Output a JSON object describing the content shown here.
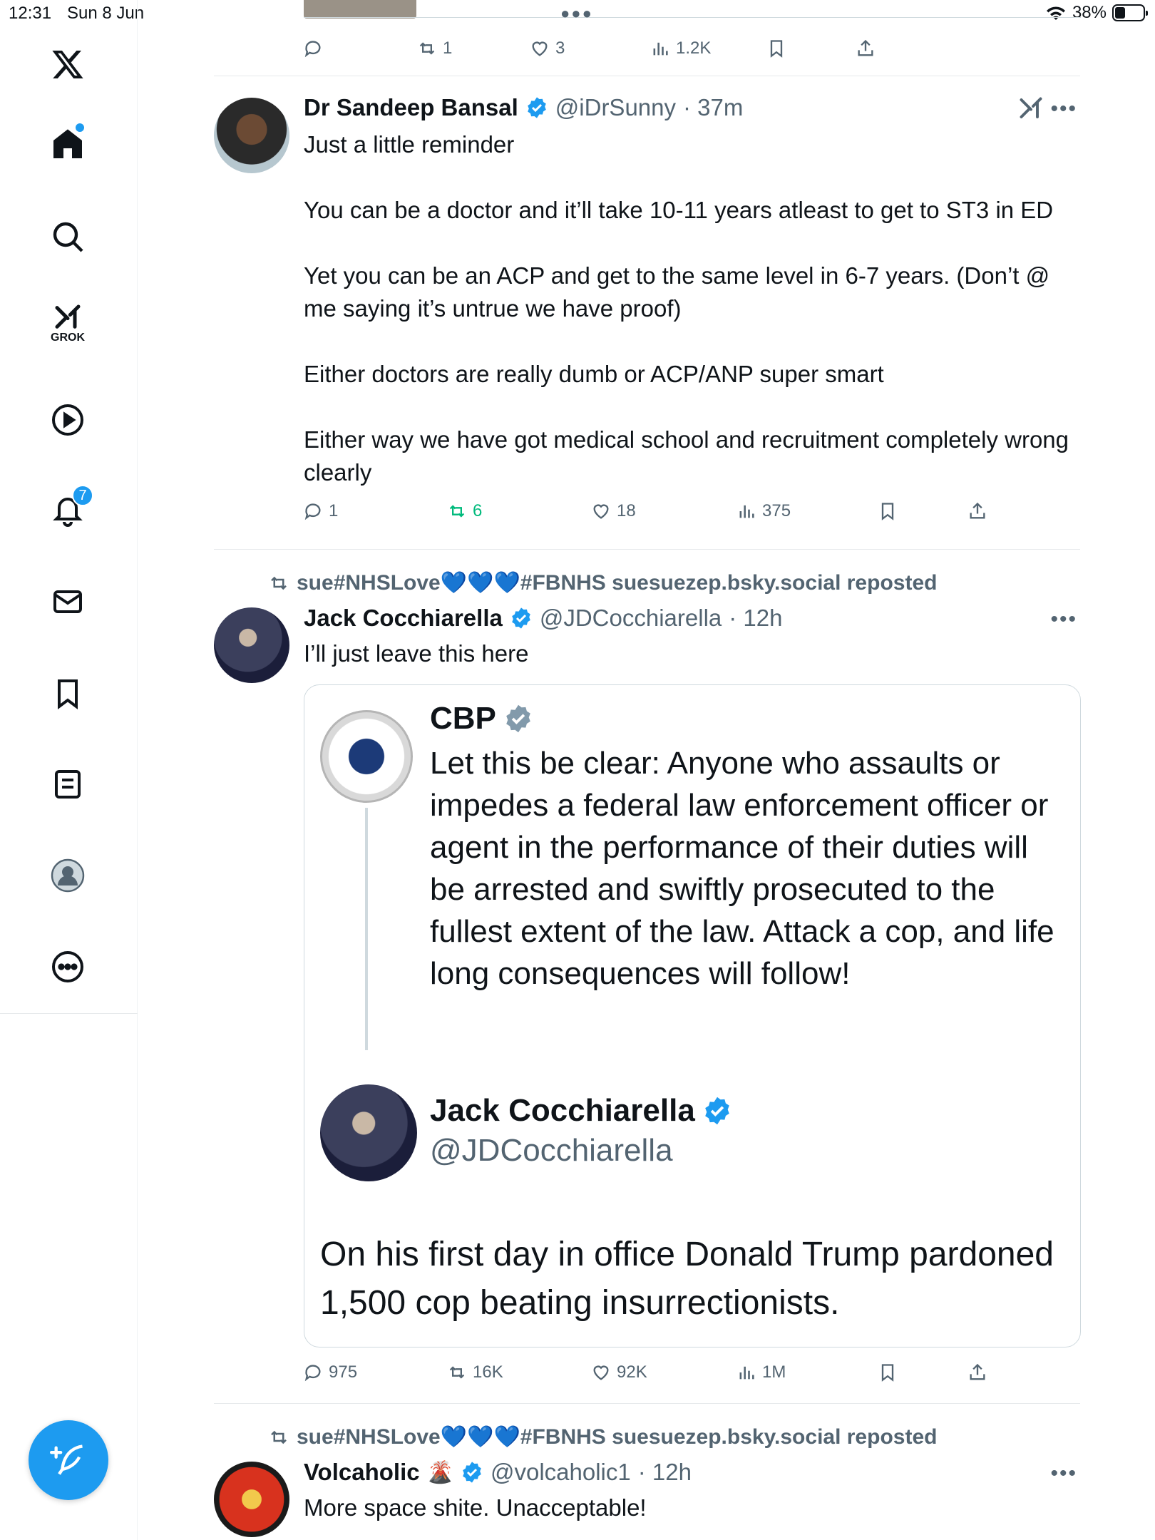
{
  "status": {
    "time": "12:31",
    "date": "Sun 8 Jun",
    "battery": "38%",
    "battery_level": 0.38
  },
  "sidebar": {
    "grok_label": "GROK",
    "notifications_count": "7",
    "items": [
      "x-logo",
      "home",
      "search",
      "grok",
      "video",
      "notifications",
      "messages",
      "bookmarks",
      "lists",
      "profile",
      "more"
    ]
  },
  "top_tweet": {
    "actions": {
      "replies": "",
      "reposts": "1",
      "likes": "3",
      "views": "1.2K"
    }
  },
  "tweet1": {
    "name": "Dr Sandeep Bansal",
    "handle": "@iDrSunny",
    "time": "· 37m",
    "text": "Just a little reminder\n\nYou can be a doctor and it’ll take 10-11 years atleast to get to ST3 in ED\n\nYet you can be an ACP and get to the same level in 6-7 years. (Don’t @ me saying it’s untrue we have proof)\n\nEither doctors are really dumb or ACP/ANP super smart\n\nEither way we have got medical school and recruitment completely wrong clearly",
    "actions": {
      "replies": "1",
      "reposts": "6",
      "likes": "18",
      "views": "375"
    }
  },
  "tweet2": {
    "repost_line": "sue#NHSLove💙💙💙#FBNHS suesuezep.bsky.social reposted",
    "name": "Jack Cocchiarella",
    "handle": "@JDCocchiarella",
    "time": "· 12h",
    "text": "I’ll just leave this here",
    "quote": {
      "cbp_name": "CBP",
      "cbp_text": "Let this be clear: Anyone who assaults or impedes a federal law enforcement officer or agent in the performance of their duties will be arrested and swiftly prosecuted to the fullest extent of the law. Attack a cop, and life long consequences will follow!",
      "reply_name": "Jack Cocchiarella",
      "reply_handle": "@JDCocchiarella",
      "reply_text": "On his first day in office Donald Trump pardoned 1,500 cop beating insurrectionists."
    },
    "actions": {
      "replies": "975",
      "reposts": "16K",
      "likes": "92K",
      "views": "1M"
    }
  },
  "tweet3": {
    "repost_line": "sue#NHSLove💙💙💙#FBNHS suesuezep.bsky.social reposted",
    "name": "Volcaholic",
    "name_emoji": "🌋",
    "handle": "@volcaholic1",
    "time": "· 12h",
    "text": "More space shite. Unacceptable!"
  }
}
